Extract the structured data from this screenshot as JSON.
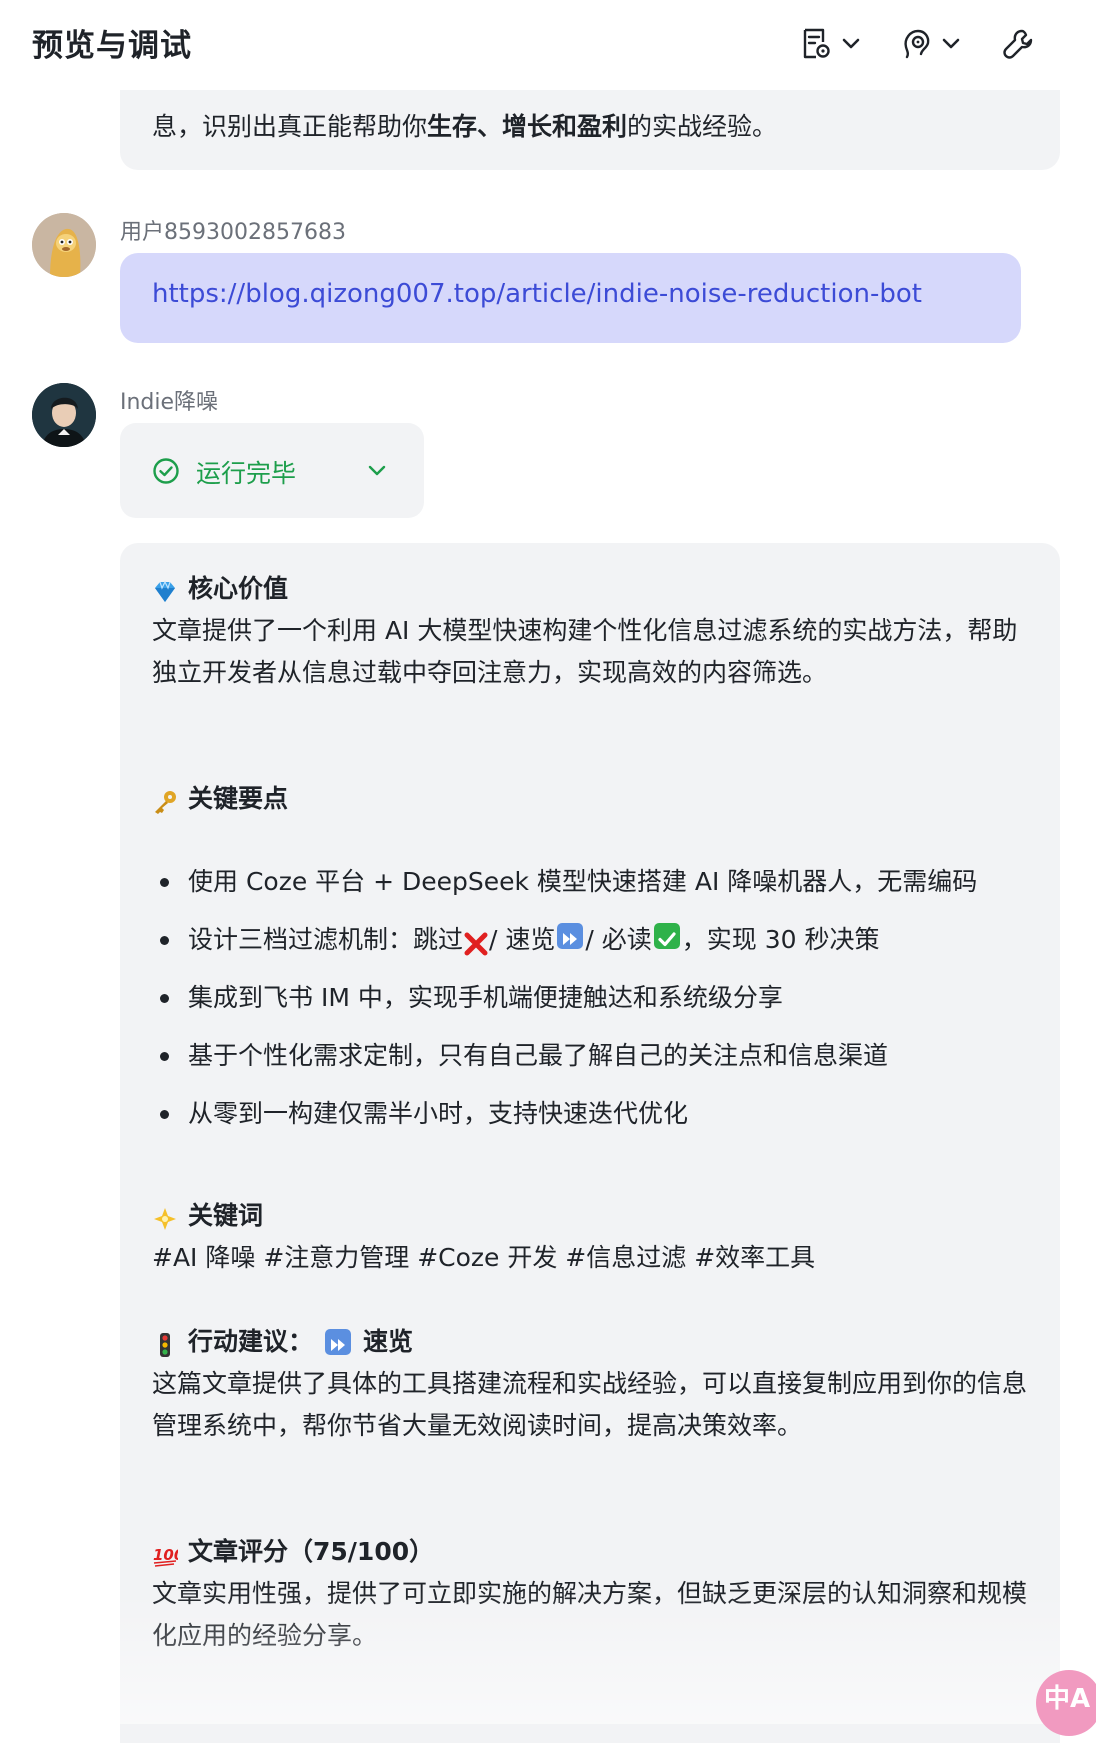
{
  "header": {
    "title": "预览与调试",
    "icons": [
      "document-settings-icon",
      "chevron-down-icon",
      "earpiece-settings-icon",
      "chevron-down-icon",
      "wrench-icon"
    ]
  },
  "previous_message": {
    "text_before": "息，识别出真正能帮助你",
    "text_bold": "生存、增长和盈利",
    "text_after": "的实战经验。"
  },
  "user_message": {
    "sender": "用户8593002857683",
    "link": "https://blog.qizong007.top/article/indie-noise-reduction-bot"
  },
  "bot_message": {
    "sender": "Indie降噪",
    "status": "运行完毕",
    "core_value": {
      "heading": "核心价值",
      "body": "文章提供了一个利用 AI 大模型快速构建个性化信息过滤系统的实战方法，帮助独立开发者从信息过载中夺回注意力，实现高效的内容筛选。"
    },
    "key_points": {
      "heading": "关键要点",
      "items": [
        "使用 Coze 平台 + DeepSeek 模型快速搭建 AI 降噪机器人，无需编码",
        "设计三档过滤机制：跳过",
        "集成到飞书 IM 中，实现手机端便捷触达和系统级分享",
        "基于个性化需求定制，只有自己最了解自己的关注点和信息渠道",
        "从零到一构建仅需半小时，支持快速迭代优化"
      ],
      "item2_part2": "/ 速览",
      "item2_part3": "/ 必读",
      "item2_part4": "，实现 30 秒决策"
    },
    "keywords": {
      "heading": "关键词",
      "body": "#AI 降噪 #注意力管理 #Coze 开发 #信息过滤 #效率工具"
    },
    "action": {
      "heading_a": "行动建议：",
      "heading_b": "速览",
      "body": "这篇文章提供了具体的工具搭建流程和实战经验，可以直接复制应用到你的信息管理系统中，帮你节省大量无效阅读时间，提高决策效率。"
    },
    "score": {
      "heading": "文章评分（75/100）",
      "body": "文章实用性强，提供了可立即实施的解决方案，但缺乏更深层的认知洞察和规模化应用的经验分享。"
    }
  },
  "floating_button": {
    "label": "中A"
  },
  "colors": {
    "bubble_gray": "#f2f3f5",
    "user_bubble": "#d6d8fb",
    "link": "#3c4bd6",
    "success": "#1d9e4b"
  }
}
